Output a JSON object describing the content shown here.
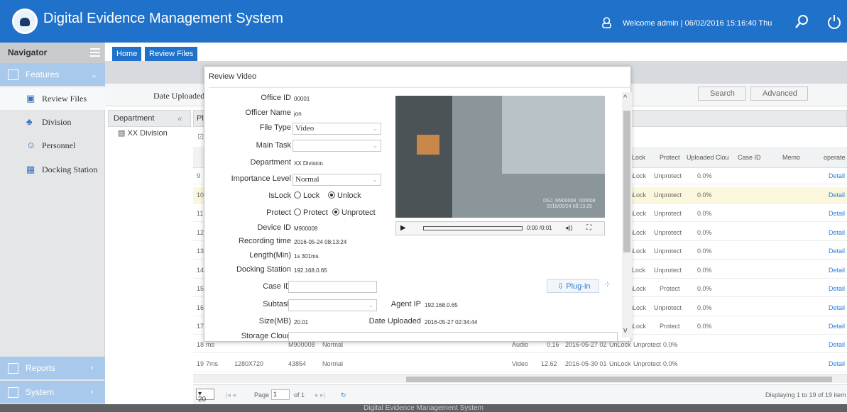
{
  "header": {
    "app_title": "Digital Evidence Management System",
    "welcome": "Welcome  admin |  06/02/2016 15:16:40 Thu"
  },
  "sidebar": {
    "title": "Navigator",
    "features": "Features",
    "items": [
      {
        "label": "Review Files"
      },
      {
        "label": "Division"
      },
      {
        "label": "Personnel"
      },
      {
        "label": "Docking Station"
      }
    ],
    "reports": "Reports",
    "system": "System"
  },
  "tabs": [
    {
      "label": "Home"
    },
    {
      "label": "Review Files"
    }
  ],
  "filter": {
    "date_uploaded_label": "Date Uploaded",
    "search_label": "Search",
    "advanced_label": "Advanced"
  },
  "department_panel": {
    "header": "Department",
    "item": "XX Division"
  },
  "grid": {
    "strip_label": "Pla",
    "columns": [
      "Lock",
      "Protect",
      "Uploaded Clou",
      "Case ID",
      "Memo",
      "operate"
    ],
    "rows": [
      {
        "no": "9",
        "lock": "nLock",
        "protect": "Unprotect",
        "cloud": "0.0%",
        "op": "Detail"
      },
      {
        "no": "10",
        "lock": "nLock",
        "protect": "Unprotect",
        "cloud": "0.0%",
        "op": "Detail"
      },
      {
        "no": "11",
        "lock": "nLock",
        "protect": "Unprotect",
        "cloud": "0.0%",
        "op": "Detail"
      },
      {
        "no": "12",
        "lock": "nLock",
        "protect": "Unprotect",
        "cloud": "0.0%",
        "op": "Detail"
      },
      {
        "no": "13",
        "lock": "nLock",
        "protect": "Unprotect",
        "cloud": "0.0%",
        "op": "Detail"
      },
      {
        "no": "14",
        "lock": "Lock",
        "protect": "Unprotect",
        "cloud": "0.0%",
        "op": "Detail"
      },
      {
        "no": "15",
        "lock": "nLock",
        "protect": "Protect",
        "cloud": "0.0%",
        "op": "Detail"
      },
      {
        "no": "16",
        "lock": "nLock",
        "protect": "Unprotect",
        "cloud": "0.0%",
        "op": "Detail"
      },
      {
        "no": "17",
        "lock": "nLock",
        "protect": "Protect",
        "cloud": "0.0%",
        "op": "Detail"
      }
    ],
    "row18": {
      "no": "18",
      "ms": "ms",
      "device": "M900008",
      "level": "Normal",
      "type": "Audio",
      "size": "0.16",
      "date": "2016-05-27 02",
      "lock": "UnLock",
      "protect": "Unprotect",
      "cloud": "0.0%",
      "op": "Detail"
    },
    "row19": {
      "no": "19",
      "ms": "7ms",
      "res": "1280X720",
      "num": "43854",
      "level": "Normal",
      "type": "Video",
      "size": "12.62",
      "date": "2016-05-30 01",
      "lock": "UnLock",
      "protect": "Unprotect",
      "cloud": "0.0%",
      "op": "Detail"
    }
  },
  "pager": {
    "page_size": "20",
    "page_label": "Page",
    "page_value": "1",
    "of": "of 1",
    "displaying": "Displaying 1 to 19 of 19 item"
  },
  "footer": "Digital Evidence Management System",
  "modal": {
    "title": "Review Video",
    "fields": {
      "office_id_label": "Office ID",
      "office_id": "00001",
      "officer_name_label": "Officer Name",
      "officer_name": "jon",
      "file_type_label": "File Type",
      "file_type": "Video",
      "main_task_label": "Main Task",
      "department_label": "Department",
      "department": "XX Division",
      "importance_label": "Importance Level",
      "importance": "Normal",
      "islock_label": "IsLock",
      "lock_opt": "Lock",
      "unlock_opt": "Unlock",
      "protect_label": "Protect",
      "protect_opt": "Protect",
      "unprotect_opt": "Unprotect",
      "device_id_label": "Device ID",
      "device_id": "M900008",
      "recording_label": "Recording time",
      "recording": "2016-05-24 08:13:24",
      "length_label": "Length(Min)",
      "length": "1s 301ms",
      "docking_label": "Docking Station",
      "docking": "192.168.0.65",
      "case_id_label": "Case ID",
      "subtask_label": "Subtask",
      "size_label": "Size(MB)",
      "size": "20.01",
      "storage_label": "Storage Cloud",
      "agent_ip_label": "Agent IP",
      "agent_ip": "192.168.0.65",
      "date_uploaded_label": "Date Uploaded",
      "date_uploaded": "2016-05-27 02:34:44"
    },
    "video": {
      "stamp": "DSJ_M900008_000008\n2016/05/24 08:13:25",
      "time": "0:00 /0:01"
    },
    "plugin_label": "Plug-in"
  },
  "colors": {
    "primary": "#1f71c9",
    "sidebar_section": "#a8c9ec",
    "link": "#2f7cd4",
    "row_highlight": "#fbf7dc"
  }
}
